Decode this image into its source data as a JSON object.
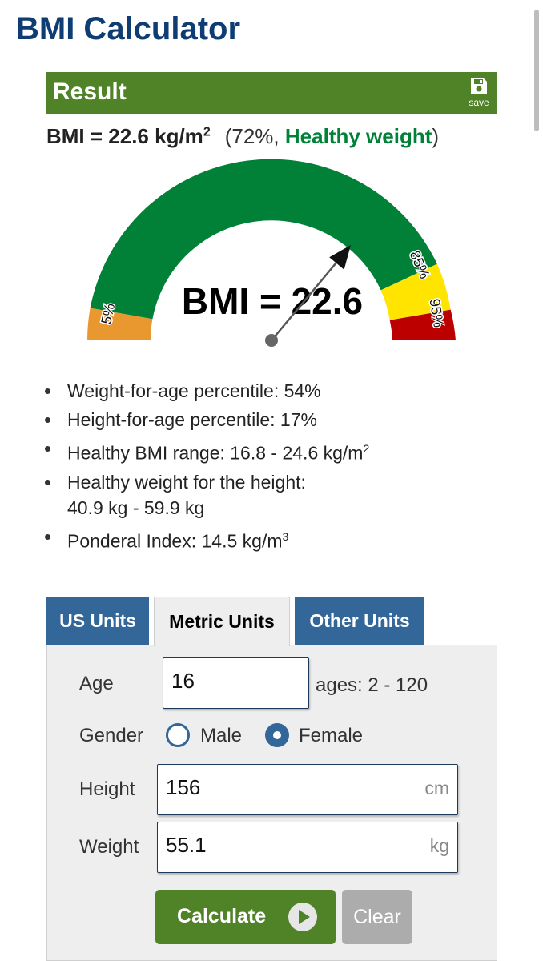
{
  "page": {
    "title": "BMI Calculator"
  },
  "result": {
    "title": "Result",
    "save_label": "save",
    "bmi_text": "BMI = 22.6 kg/m",
    "bmi_sup": "2",
    "paren_open": "(",
    "percentile": "72%,",
    "category": "Healthy weight",
    "paren_close": ")"
  },
  "gauge": {
    "label_5": "5%",
    "label_85": "85%",
    "label_95": "95%",
    "center_text": "BMI = 22.6",
    "colors": {
      "underweight": "#e8982f",
      "healthy": "#008137",
      "overweight": "#ffe400",
      "obese": "#bc0000"
    }
  },
  "details": [
    {
      "text": "Weight-for-age percentile: 54%"
    },
    {
      "text": "Height-for-age percentile: 17%"
    },
    {
      "text": "Healthy BMI range: 16.8 - 24.6 kg/m",
      "sup": "2"
    },
    {
      "text": "Healthy weight for the height:",
      "text2": "40.9 kg - 59.9 kg"
    },
    {
      "text": "Ponderal Index: 14.5 kg/m",
      "sup": "3"
    }
  ],
  "tabs": [
    {
      "label": "US Units"
    },
    {
      "label": "Metric Units"
    },
    {
      "label": "Other Units"
    }
  ],
  "form": {
    "age": {
      "label": "Age",
      "value": "16",
      "hint": "ages: 2 - 120"
    },
    "gender": {
      "label": "Gender",
      "male": "Male",
      "female": "Female",
      "selected": "Female"
    },
    "height": {
      "label": "Height",
      "value": "156",
      "unit": "cm"
    },
    "weight": {
      "label": "Weight",
      "value": "55.1",
      "unit": "kg"
    },
    "calculate": "Calculate",
    "clear": "Clear"
  }
}
